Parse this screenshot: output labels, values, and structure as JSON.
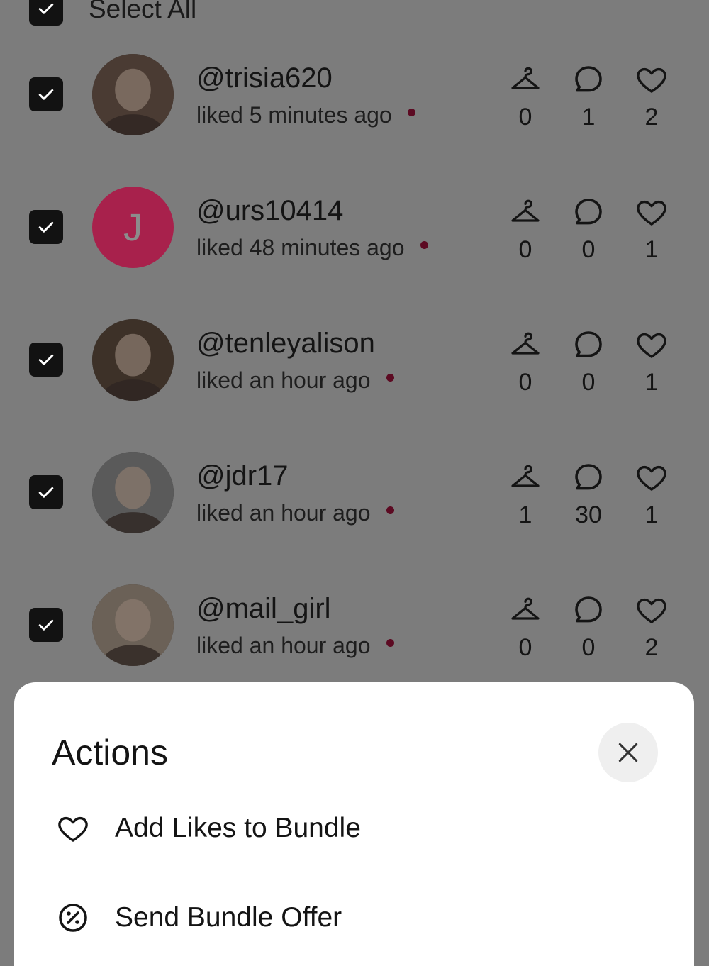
{
  "header": {
    "select_all_label": "Select All"
  },
  "users": [
    {
      "username": "@trisia620",
      "activity": "liked 5 minutes ago",
      "stats": [
        "0",
        "1",
        "2"
      ],
      "avatar": "photo"
    },
    {
      "username": "@urs10414",
      "activity": "liked 48 minutes ago",
      "stats": [
        "0",
        "0",
        "1"
      ],
      "avatar": "initial",
      "initial": "J"
    },
    {
      "username": "@tenleyalison",
      "activity": "liked an hour ago",
      "stats": [
        "0",
        "0",
        "1"
      ],
      "avatar": "photo"
    },
    {
      "username": "@jdr17",
      "activity": "liked an hour ago",
      "stats": [
        "1",
        "30",
        "1"
      ],
      "avatar": "photo"
    },
    {
      "username": "@mail_girl",
      "activity": "liked an hour ago",
      "stats": [
        "0",
        "0",
        "2"
      ],
      "avatar": "photo"
    }
  ],
  "stat_icons": [
    "hanger-icon",
    "comment-icon",
    "heart-icon"
  ],
  "sheet": {
    "title": "Actions",
    "actions": [
      {
        "label": "Add Likes to Bundle",
        "icon": "heart-icon"
      },
      {
        "label": "Send Bundle Offer",
        "icon": "percent-badge-icon"
      }
    ]
  },
  "colors": {
    "overlay": "#7c7c7c",
    "checkbox": "#121212",
    "accent_avatar": "#a8214c",
    "unread_dot": "#5c0a22",
    "sheet_bg": "#ffffff"
  }
}
